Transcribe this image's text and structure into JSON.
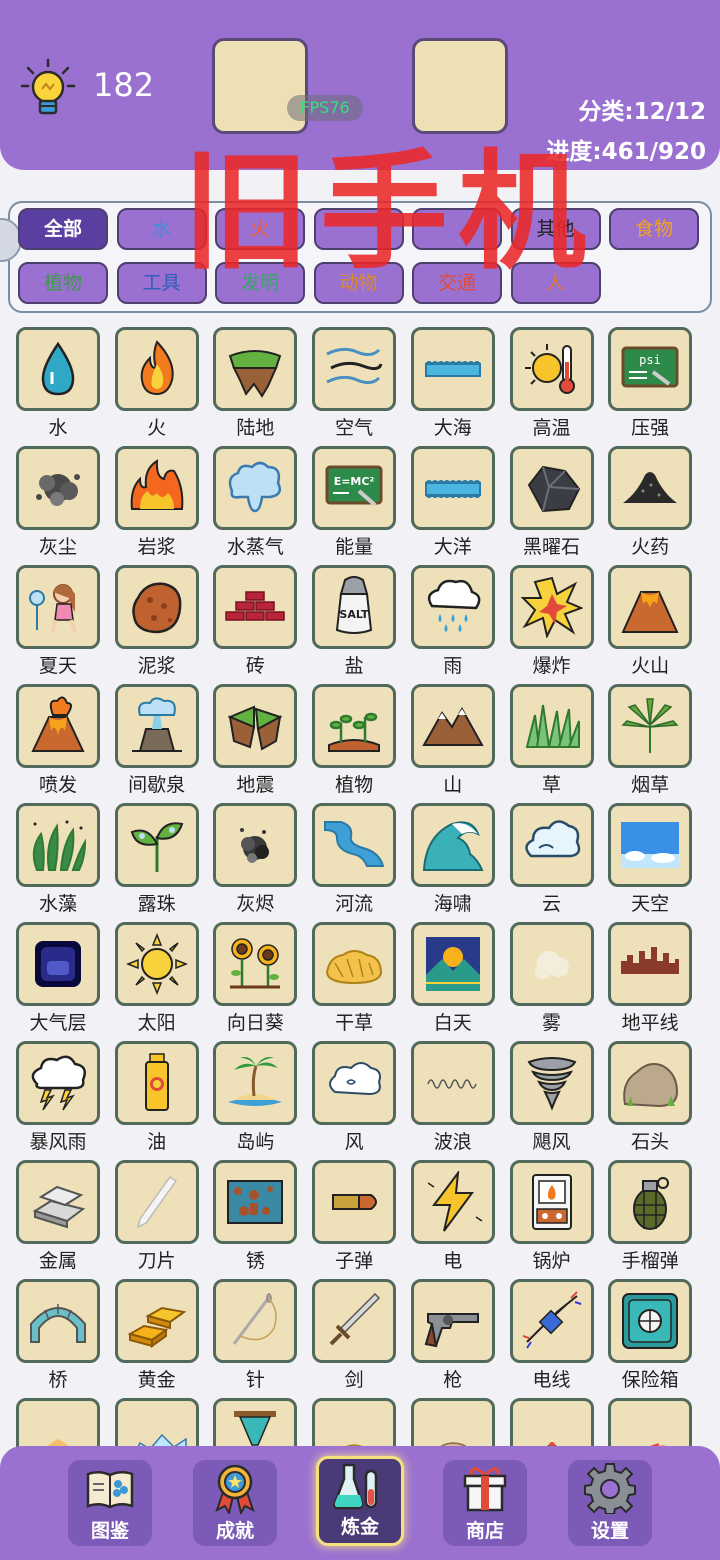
{
  "header": {
    "score": "182",
    "fps": "FPS76",
    "category_stat": "分类:12/12",
    "progress_stat": "进度:461/920",
    "watermark": "旧手机"
  },
  "filters": [
    {
      "label": "全部",
      "color": "#ffffff",
      "active": true
    },
    {
      "label": "水",
      "color": "#3f8fd6"
    },
    {
      "label": "火",
      "color": "#f25c2b"
    },
    {
      "label": "",
      "color": "#333"
    },
    {
      "label": "",
      "color": "#333"
    },
    {
      "label": "其他",
      "color": "#222"
    },
    {
      "label": "食物",
      "color": "#f0a12a"
    },
    {
      "label": "植物",
      "color": "#3c9a4a"
    },
    {
      "label": "工具",
      "color": "#2f5fb8"
    },
    {
      "label": "发明",
      "color": "#3aa56a"
    },
    {
      "label": "动物",
      "color": "#d98a2a"
    },
    {
      "label": "交通",
      "color": "#e24a3a"
    },
    {
      "label": "人",
      "color": "#e07a30"
    }
  ],
  "items": [
    {
      "label": "水",
      "icon": "water-drop-icon"
    },
    {
      "label": "火",
      "icon": "flame-icon"
    },
    {
      "label": "陆地",
      "icon": "land-icon"
    },
    {
      "label": "空气",
      "icon": "air-icon"
    },
    {
      "label": "大海",
      "icon": "sea-icon"
    },
    {
      "label": "高温",
      "icon": "heat-icon"
    },
    {
      "label": "压强",
      "icon": "pressure-icon"
    },
    {
      "label": "灰尘",
      "icon": "dust-icon"
    },
    {
      "label": "岩浆",
      "icon": "lava-icon"
    },
    {
      "label": "水蒸气",
      "icon": "steam-icon"
    },
    {
      "label": "能量",
      "icon": "energy-icon"
    },
    {
      "label": "大洋",
      "icon": "ocean-icon"
    },
    {
      "label": "黑曜石",
      "icon": "obsidian-icon"
    },
    {
      "label": "火药",
      "icon": "gunpowder-icon"
    },
    {
      "label": "夏天",
      "icon": "summer-icon"
    },
    {
      "label": "泥浆",
      "icon": "mud-icon"
    },
    {
      "label": "砖",
      "icon": "brick-icon"
    },
    {
      "label": "盐",
      "icon": "salt-icon"
    },
    {
      "label": "雨",
      "icon": "rain-icon"
    },
    {
      "label": "爆炸",
      "icon": "explosion-icon"
    },
    {
      "label": "火山",
      "icon": "volcano-icon"
    },
    {
      "label": "喷发",
      "icon": "eruption-icon"
    },
    {
      "label": "间歇泉",
      "icon": "geyser-icon"
    },
    {
      "label": "地震",
      "icon": "earthquake-icon"
    },
    {
      "label": "植物",
      "icon": "plant-icon"
    },
    {
      "label": "山",
      "icon": "mountain-icon"
    },
    {
      "label": "草",
      "icon": "grass-icon"
    },
    {
      "label": "烟草",
      "icon": "tobacco-icon"
    },
    {
      "label": "水藻",
      "icon": "algae-icon"
    },
    {
      "label": "露珠",
      "icon": "dew-icon"
    },
    {
      "label": "灰烬",
      "icon": "ash-icon"
    },
    {
      "label": "河流",
      "icon": "river-icon"
    },
    {
      "label": "海啸",
      "icon": "tsunami-icon"
    },
    {
      "label": "云",
      "icon": "cloud-icon"
    },
    {
      "label": "天空",
      "icon": "sky-icon"
    },
    {
      "label": "大气层",
      "icon": "atmosphere-icon"
    },
    {
      "label": "太阳",
      "icon": "sun-icon"
    },
    {
      "label": "向日葵",
      "icon": "sunflower-icon"
    },
    {
      "label": "干草",
      "icon": "hay-icon"
    },
    {
      "label": "白天",
      "icon": "daytime-icon"
    },
    {
      "label": "雾",
      "icon": "fog-icon"
    },
    {
      "label": "地平线",
      "icon": "horizon-icon"
    },
    {
      "label": "暴风雨",
      "icon": "storm-icon"
    },
    {
      "label": "油",
      "icon": "oil-icon"
    },
    {
      "label": "岛屿",
      "icon": "island-icon"
    },
    {
      "label": "风",
      "icon": "wind-icon"
    },
    {
      "label": "波浪",
      "icon": "wave-icon"
    },
    {
      "label": "飓风",
      "icon": "hurricane-icon"
    },
    {
      "label": "石头",
      "icon": "stone-icon"
    },
    {
      "label": "金属",
      "icon": "metal-icon"
    },
    {
      "label": "刀片",
      "icon": "blade-icon"
    },
    {
      "label": "锈",
      "icon": "rust-icon"
    },
    {
      "label": "子弹",
      "icon": "bullet-icon"
    },
    {
      "label": "电",
      "icon": "electricity-icon"
    },
    {
      "label": "锅炉",
      "icon": "boiler-icon"
    },
    {
      "label": "手榴弹",
      "icon": "grenade-icon"
    },
    {
      "label": "桥",
      "icon": "bridge-icon"
    },
    {
      "label": "黄金",
      "icon": "gold-icon"
    },
    {
      "label": "针",
      "icon": "needle-icon"
    },
    {
      "label": "剑",
      "icon": "sword-icon"
    },
    {
      "label": "枪",
      "icon": "gun-icon"
    },
    {
      "label": "电线",
      "icon": "wire-icon"
    },
    {
      "label": "保险箱",
      "icon": "safe-icon"
    },
    {
      "label": "",
      "icon": "sand-icon"
    },
    {
      "label": "",
      "icon": "glacier-icon"
    },
    {
      "label": "",
      "icon": "hourglass-icon"
    },
    {
      "label": "",
      "icon": "bread-icon"
    },
    {
      "label": "",
      "icon": "rock-icon"
    },
    {
      "label": "",
      "icon": "cactus-icon"
    },
    {
      "label": "",
      "icon": "glasses-icon"
    }
  ],
  "nav": [
    {
      "label": "图鉴",
      "icon": "book-icon"
    },
    {
      "label": "成就",
      "icon": "medal-icon"
    },
    {
      "label": "炼金",
      "icon": "flask-icon",
      "active": true
    },
    {
      "label": "商店",
      "icon": "gift-icon"
    },
    {
      "label": "设置",
      "icon": "gear-icon"
    }
  ]
}
